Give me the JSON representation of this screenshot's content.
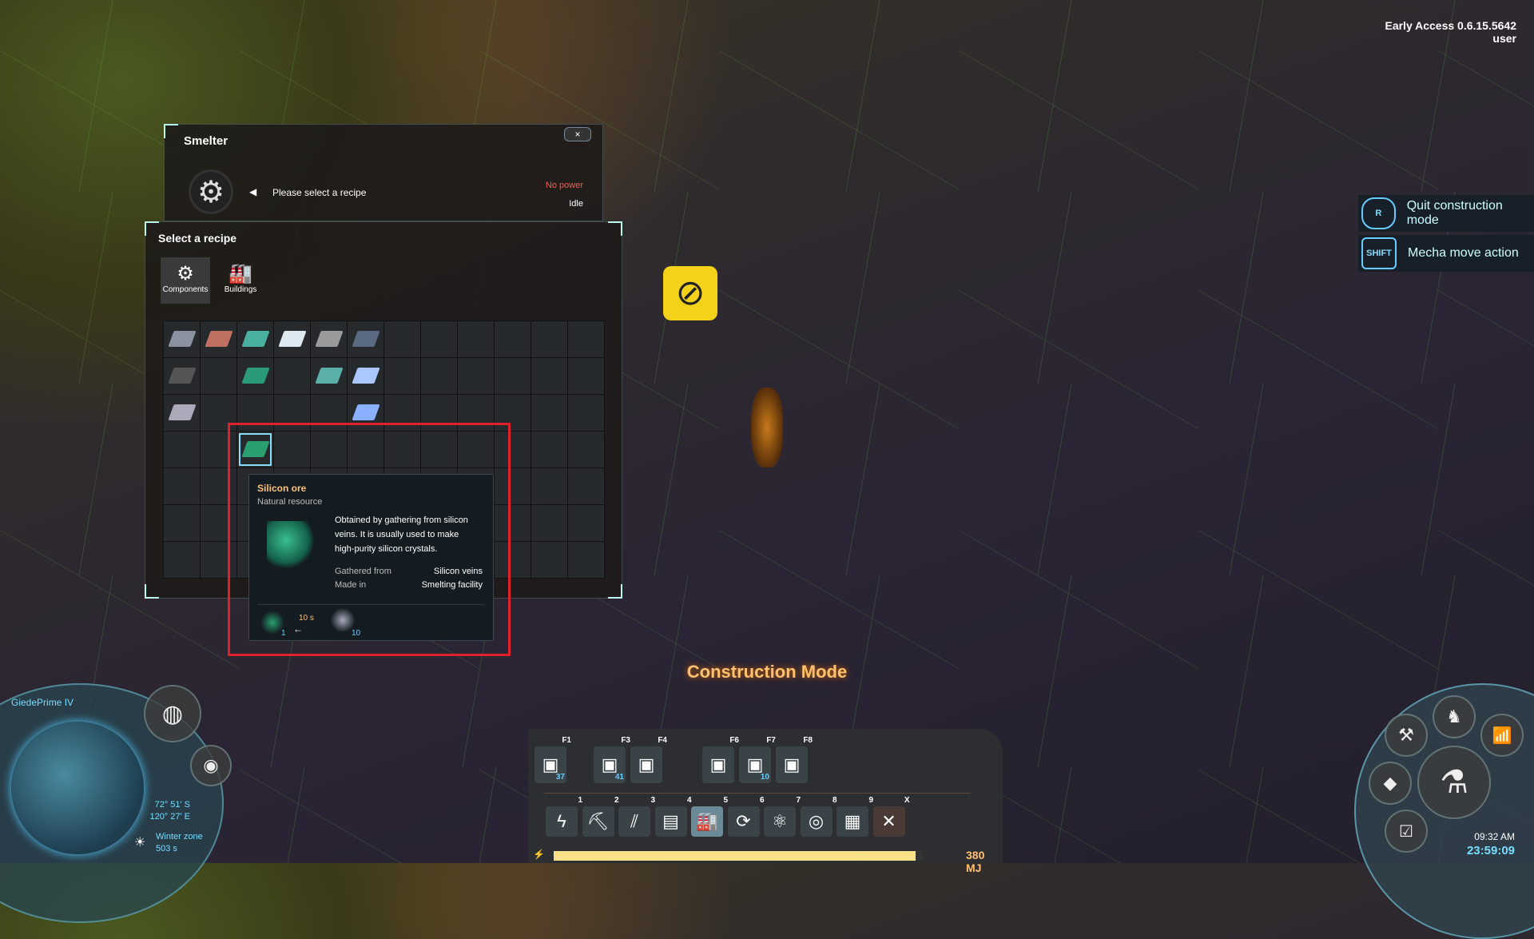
{
  "version": "Early Access 0.6.15.5642",
  "user": "user",
  "smelter": {
    "title": "Smelter",
    "recipe_prompt": "Please select a recipe",
    "power_status": "No power",
    "state": "Idle",
    "close": "×"
  },
  "recipe_panel": {
    "title": "Select a recipe",
    "tabs": [
      {
        "label": "Components",
        "icon": "gears-icon",
        "active": true
      },
      {
        "label": "Buildings",
        "icon": "factory-icon",
        "active": false
      }
    ],
    "items": [
      {
        "row": 0,
        "col": 0,
        "name": "iron-ingot",
        "color": "#8a92a0"
      },
      {
        "row": 0,
        "col": 1,
        "name": "copper-ingot",
        "color": "#c07060"
      },
      {
        "row": 0,
        "col": 2,
        "name": "silicon-plate",
        "color": "#4ab0a0"
      },
      {
        "row": 0,
        "col": 3,
        "name": "titanium-plate",
        "color": "#dde8f0"
      },
      {
        "row": 0,
        "col": 4,
        "name": "stone-brick",
        "color": "#999"
      },
      {
        "row": 0,
        "col": 5,
        "name": "steel-cylinders",
        "color": "#5a6a80"
      },
      {
        "row": 1,
        "col": 0,
        "name": "magnet-ring",
        "color": "#555"
      },
      {
        "row": 1,
        "col": 2,
        "name": "energetic-crystal",
        "color": "#2a9a7a"
      },
      {
        "row": 1,
        "col": 4,
        "name": "glass",
        "color": "#5ab0a8"
      },
      {
        "row": 1,
        "col": 5,
        "name": "diamond",
        "color": "#aac8ff"
      },
      {
        "row": 2,
        "col": 0,
        "name": "steel-beam",
        "color": "#aab"
      },
      {
        "row": 2,
        "col": 5,
        "name": "crystal-silicon",
        "color": "#8ab0ff"
      },
      {
        "row": 3,
        "col": 2,
        "name": "silicon-ore",
        "color": "#2aa070",
        "selected": true
      }
    ]
  },
  "tooltip": {
    "name": "Silicon ore",
    "type": "Natural resource",
    "description": "Obtained by gathering from silicon veins. It is usually used to make high-purity silicon crystals.",
    "gathered_from_label": "Gathered from",
    "gathered_from": "Silicon veins",
    "made_in_label": "Made in",
    "made_in": "Smelting facility",
    "recipe": {
      "output_count": "1",
      "time": "10 s",
      "input_count": "10"
    }
  },
  "hints": [
    {
      "key": "R",
      "label": "Quit construction mode"
    },
    {
      "key": "SHIFT",
      "label": "Mecha move action"
    }
  ],
  "mode_label": "Construction Mode",
  "hotbar": {
    "buildings": [
      {
        "key": "F1",
        "count": "37"
      },
      {
        "key": "F3",
        "count": "41"
      },
      {
        "key": "F4",
        "count": ""
      },
      {
        "key": "F6",
        "count": ""
      },
      {
        "key": "F7",
        "count": "10"
      },
      {
        "key": "F8",
        "count": ""
      }
    ],
    "categories": [
      {
        "key": "1",
        "icon": "power-icon"
      },
      {
        "key": "2",
        "icon": "mining-icon"
      },
      {
        "key": "3",
        "icon": "conveyor-icon"
      },
      {
        "key": "4",
        "icon": "storage-icon"
      },
      {
        "key": "5",
        "icon": "factory-icon",
        "active": true
      },
      {
        "key": "6",
        "icon": "logistics-icon"
      },
      {
        "key": "7",
        "icon": "research-icon"
      },
      {
        "key": "8",
        "icon": "dyson-icon"
      },
      {
        "key": "9",
        "icon": "foundation-icon"
      },
      {
        "key": "X",
        "icon": "dismantle-icon"
      }
    ],
    "energy": "380 MJ",
    "energy_fraction": 0.98
  },
  "planet": {
    "name": "GiedePrime IV",
    "lat": "72°  51' S",
    "lon": "120°  27' E",
    "zone": "Winter zone",
    "zone_time": "503 s"
  },
  "clock": {
    "local": "09:32 AM",
    "play_time": "23:59:09"
  },
  "colors": {
    "accent": "#6cf",
    "warning": "#ff5a4a",
    "highlight": "#ffc070",
    "selection": "#e0202a"
  }
}
